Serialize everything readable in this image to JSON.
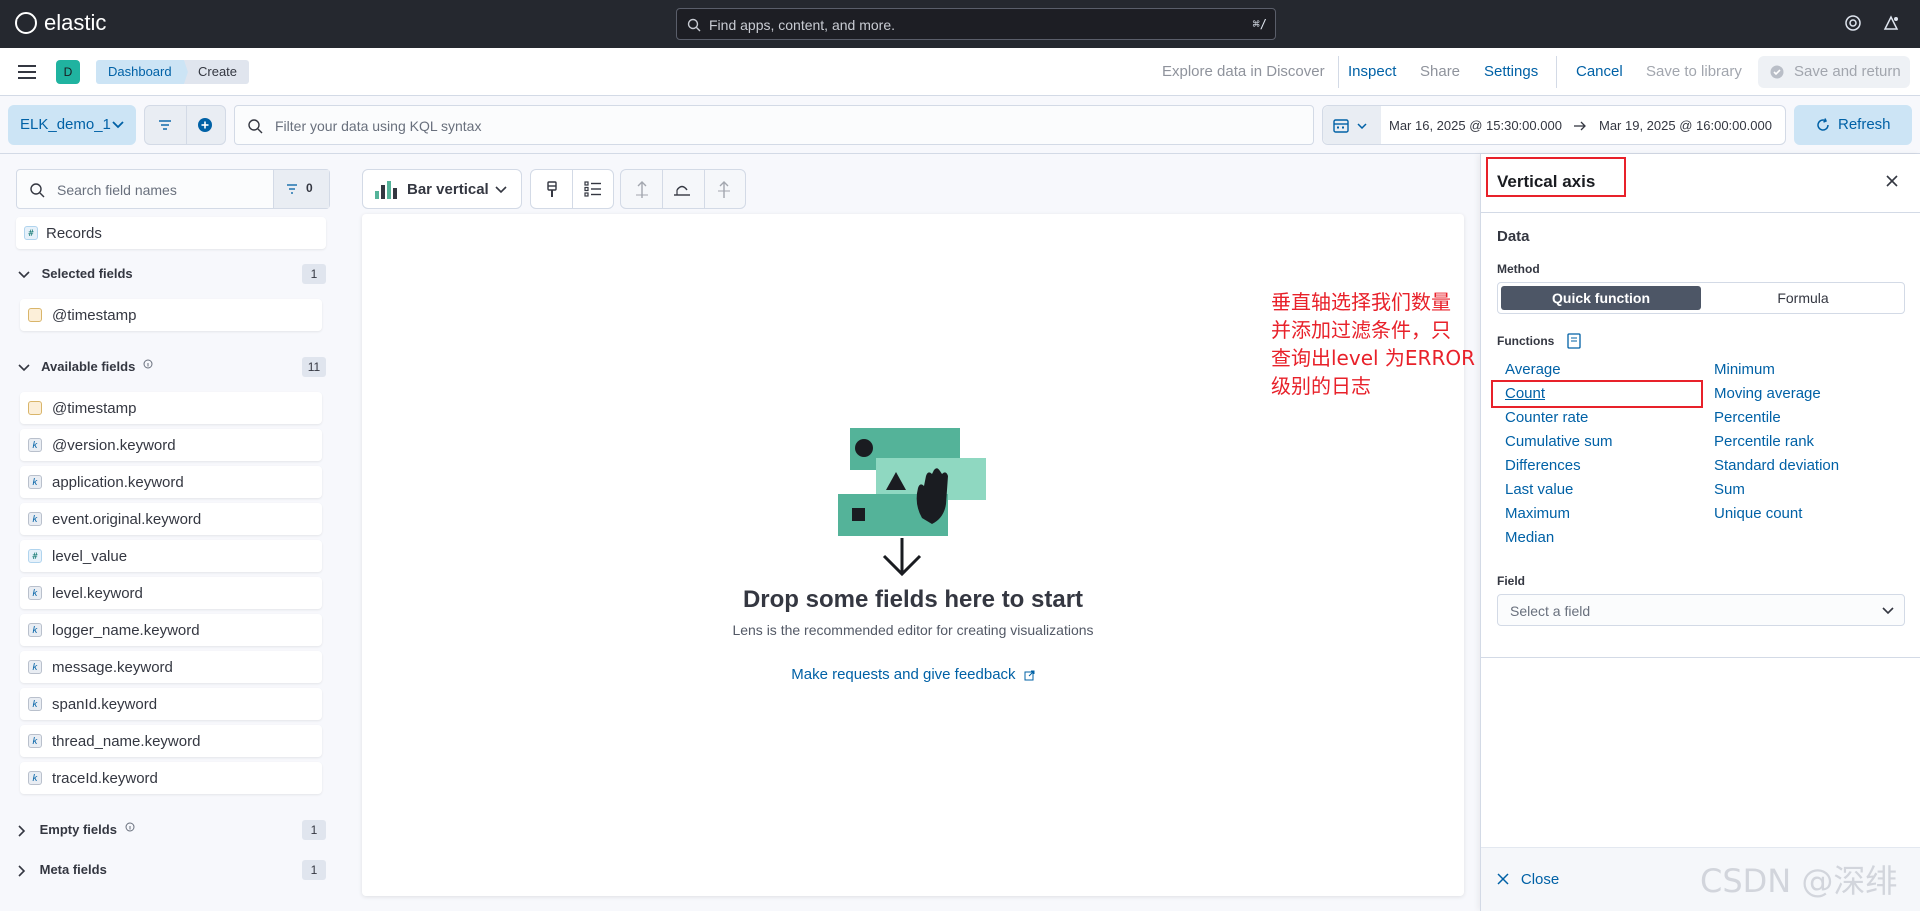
{
  "header": {
    "logo_text": "elastic",
    "search_placeholder": "Find apps, content, and more.",
    "search_shortcut": "⌘/"
  },
  "subheader": {
    "space_initial": "D",
    "breadcrumbs": [
      "Dashboard",
      "Create"
    ],
    "links": {
      "explore": "Explore data in Discover",
      "inspect": "Inspect",
      "share": "Share",
      "settings": "Settings",
      "cancel": "Cancel",
      "save_to_library": "Save to library",
      "save_and_return": "Save and return"
    }
  },
  "querybar": {
    "data_view": "ELK_demo_1",
    "kql_placeholder": "Filter your data using KQL syntax",
    "date_start": "Mar 16, 2025 @ 15:30:00.000",
    "date_end": "Mar 19, 2025 @ 16:00:00.000",
    "refresh_label": "Refresh"
  },
  "fields": {
    "search_placeholder": "Search field names",
    "filter_count": "0",
    "records_label": "Records",
    "selected": {
      "title": "Selected fields",
      "count": "1",
      "items": [
        "@timestamp"
      ]
    },
    "available": {
      "title": "Available fields",
      "count": "11",
      "items": [
        "@timestamp",
        "@version.keyword",
        "application.keyword",
        "event.original.keyword",
        "level_value",
        "level.keyword",
        "logger_name.keyword",
        "message.keyword",
        "spanId.keyword",
        "thread_name.keyword",
        "traceId.keyword"
      ]
    },
    "empty": {
      "title": "Empty fields",
      "count": "1"
    },
    "meta": {
      "title": "Meta fields",
      "count": "1"
    }
  },
  "workspace": {
    "chart_type": "Bar vertical",
    "empty_title": "Drop some fields here to start",
    "empty_subtitle": "Lens is the recommended editor for creating visualizations",
    "feedback_link": "Make requests and give feedback"
  },
  "flyout": {
    "title": "Vertical axis",
    "section_data": "Data",
    "method_label": "Method",
    "method_options": [
      "Quick function",
      "Formula"
    ],
    "functions_label": "Functions",
    "functions_left": [
      "Average",
      "Count",
      "Counter rate",
      "Cumulative sum",
      "Differences",
      "Last value",
      "Maximum",
      "Median"
    ],
    "functions_right": [
      "Minimum",
      "Moving average",
      "Percentile",
      "Percentile rank",
      "Standard deviation",
      "Sum",
      "Unique count"
    ],
    "selected_function": "Count",
    "field_label": "Field",
    "field_placeholder": "Select a field",
    "close_label": "Close"
  },
  "annotation": {
    "lines": [
      "垂直轴选择我们数量",
      "并添加过滤条件，只",
      "查询出level 为ERROR",
      "级别的日志"
    ]
  },
  "watermark": "CSDN @深绯",
  "colors": {
    "header_bg": "#25282f",
    "primary": "#0061a6",
    "annotation_red": "#e8212a",
    "illustration_green": "#54b399",
    "space_avatar": "#20b3a0"
  }
}
